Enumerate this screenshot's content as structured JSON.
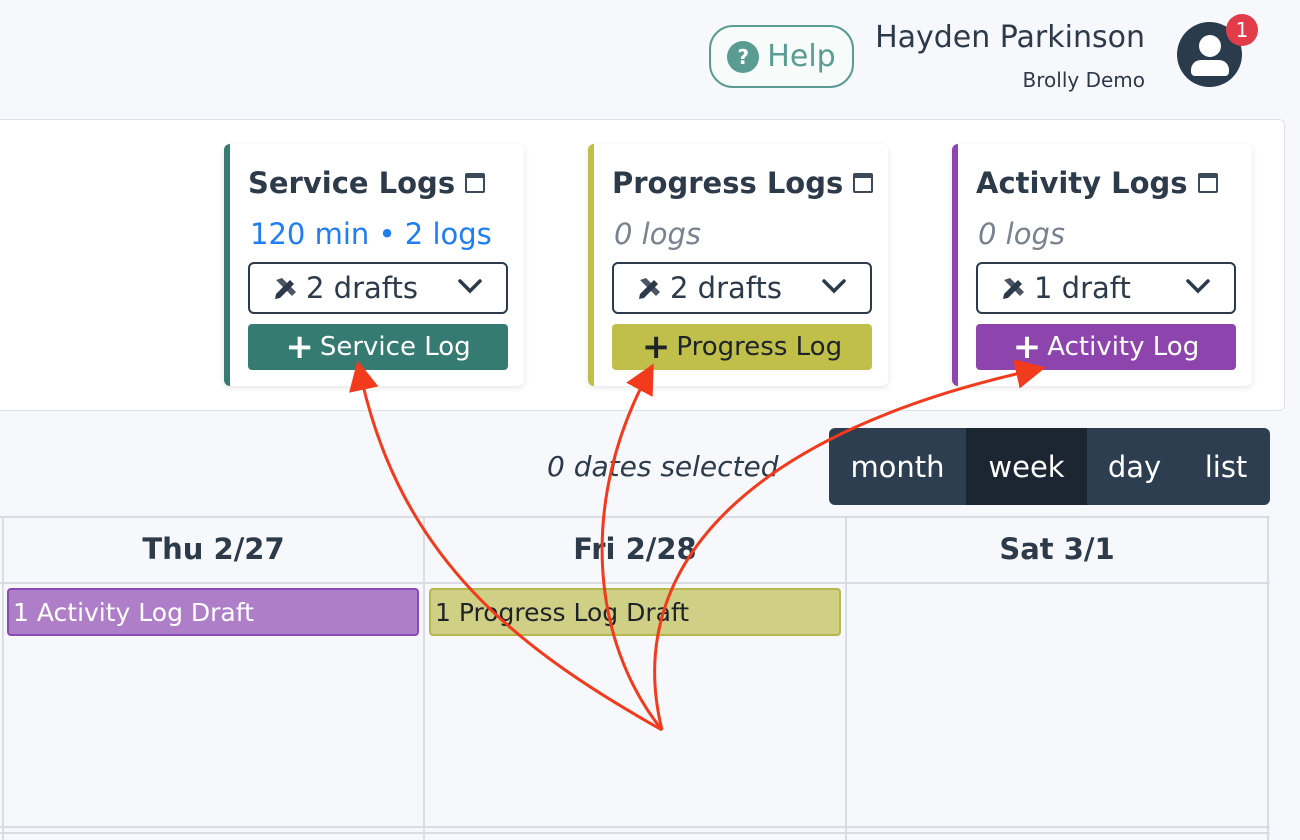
{
  "header": {
    "help_label": "Help",
    "help_icon": "question-circle-icon",
    "user_name": "Hayden Parkinson",
    "user_org": "Brolly Demo",
    "notification_count": "1"
  },
  "cards": [
    {
      "title": "Service Logs",
      "stats": "120 min • 2 logs",
      "drafts": "2 drafts",
      "add_label": "Service Log",
      "color": "#367b72"
    },
    {
      "title": "Progress Logs",
      "stats": "0 logs",
      "drafts": "2 drafts",
      "add_label": "Progress Log",
      "color": "#bfbf4a"
    },
    {
      "title": "Activity Logs",
      "stats": "0 logs",
      "drafts": "1 draft",
      "add_label": "Activity Log",
      "color": "#8e44ad"
    }
  ],
  "toolbar": {
    "dates_selected": "0 dates selected",
    "views": [
      "month",
      "week",
      "day",
      "list"
    ],
    "active_view": "week"
  },
  "calendar": {
    "days": [
      "Thu 2/27",
      "Fri 2/28",
      "Sat 3/1"
    ],
    "events": [
      {
        "day": "Thu 2/27",
        "label": "1 Activity Log Draft",
        "type": "activity"
      },
      {
        "day": "Fri 2/28",
        "label": "1 Progress Log Draft",
        "type": "progress"
      }
    ]
  },
  "colors": {
    "accent_teal": "#5a9c92",
    "link_blue": "#1f7ef0",
    "badge_red": "#e23c4b",
    "annotation_arrow": "#f23a1c"
  }
}
